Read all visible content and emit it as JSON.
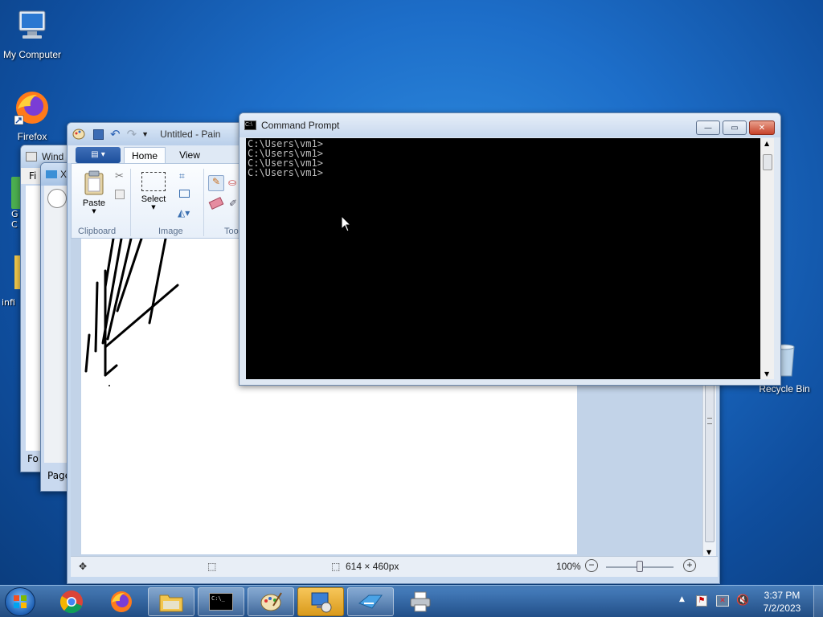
{
  "desktop": {
    "icons": [
      {
        "label": "My Computer"
      },
      {
        "label": "Firefox"
      },
      {
        "label": "Recycle Bin"
      },
      {
        "label": "infi"
      },
      {
        "label": "G"
      },
      {
        "label": "C"
      }
    ]
  },
  "background_windows": {
    "window1_title": "Wind",
    "window1_menu": "Fi",
    "window1_status": "Fo",
    "window2_title": "X",
    "window2_status": "Page"
  },
  "paint": {
    "title": "Untitled - Pain",
    "tabs": [
      {
        "label": "Home"
      },
      {
        "label": "View"
      }
    ],
    "ribbon": {
      "paste_label": "Paste",
      "select_label": "Select",
      "groups": {
        "clipboard": "Clipboard",
        "image": "Image",
        "tools": "Too"
      }
    },
    "status": {
      "canvas_size": "614 × 460px",
      "zoom": "100%"
    }
  },
  "cmd": {
    "title": "Command Prompt",
    "lines": [
      "C:\\Users\\vm1>",
      "C:\\Users\\vm1>",
      "C:\\Users\\vm1>",
      "C:\\Users\\vm1>"
    ]
  },
  "taskbar": {
    "clock_time": "3:37 PM",
    "clock_date": "7/2/2023"
  },
  "colors": {
    "accent": "#1e6fc8",
    "close_red": "#c6422a",
    "taskbar_highlight": "#d99a1b"
  }
}
